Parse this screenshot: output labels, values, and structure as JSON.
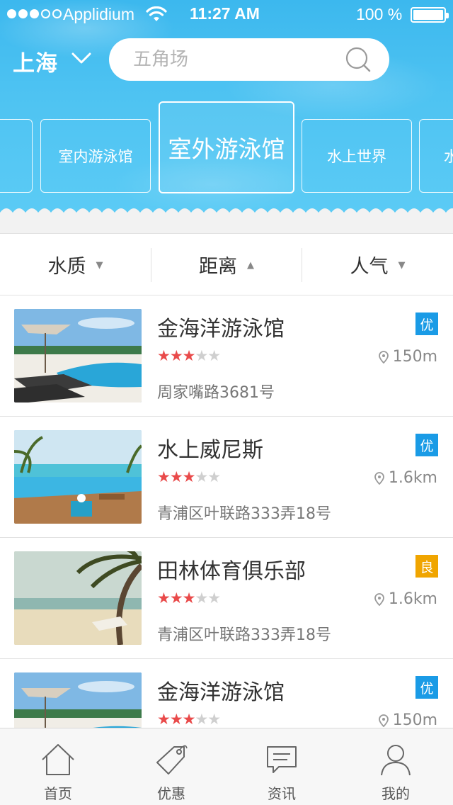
{
  "status_bar": {
    "carrier": "Applidium",
    "time": "11:27 AM",
    "battery": "100 %"
  },
  "header": {
    "city": "上海",
    "search": {
      "placeholder": "五角场"
    }
  },
  "categories": [
    {
      "label": "",
      "active": false
    },
    {
      "label": "室内游泳馆",
      "active": false
    },
    {
      "label": "室外游泳馆",
      "active": true
    },
    {
      "label": "水上世界",
      "active": false
    },
    {
      "label": "水",
      "active": false
    }
  ],
  "filters": [
    {
      "label": "水质",
      "arrow": "▼"
    },
    {
      "label": "距离",
      "arrow": "▲"
    },
    {
      "label": "人气",
      "arrow": "▼"
    }
  ],
  "venues": [
    {
      "name": "金海洋游泳馆",
      "rating": 3,
      "max_rating": 5,
      "address": "周家嘴路3681号",
      "badge": "优",
      "badge_color": "#1a9be6",
      "distance": "150m"
    },
    {
      "name": "水上威尼斯",
      "rating": 3,
      "max_rating": 5,
      "address": "青浦区叶联路333弄18号",
      "badge": "优",
      "badge_color": "#1a9be6",
      "distance": "1.6km"
    },
    {
      "name": "田林体育俱乐部",
      "rating": 3,
      "max_rating": 5,
      "address": "青浦区叶联路333弄18号",
      "badge": "良",
      "badge_color": "#f0a500",
      "distance": "1.6km"
    },
    {
      "name": "金海洋游泳馆",
      "rating": 3,
      "max_rating": 5,
      "address": "",
      "badge": "优",
      "badge_color": "#1a9be6",
      "distance": "150m"
    }
  ],
  "tabs": [
    {
      "label": "首页",
      "icon": "home-icon"
    },
    {
      "label": "优惠",
      "icon": "tag-icon"
    },
    {
      "label": "资讯",
      "icon": "message-icon"
    },
    {
      "label": "我的",
      "icon": "user-icon"
    }
  ],
  "colors": {
    "header_blue": "#4ec3f2",
    "star_on": "#e94a4a",
    "badge_good": "#1a9be6",
    "badge_fair": "#f0a500"
  }
}
